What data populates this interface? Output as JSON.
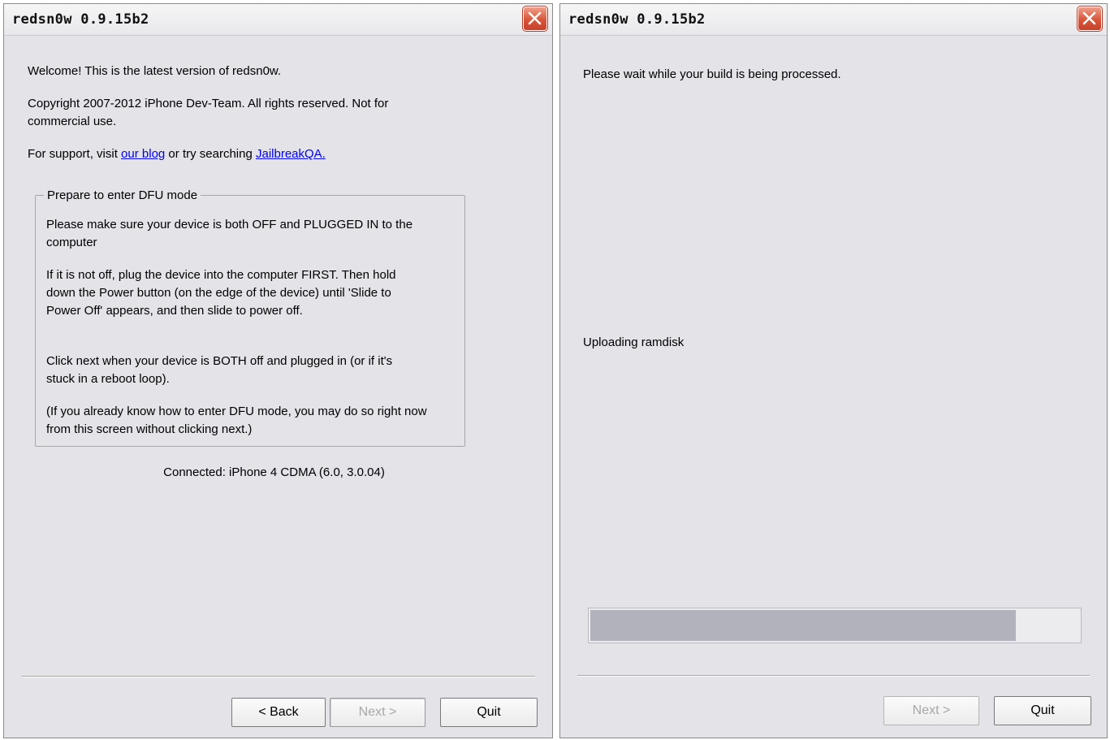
{
  "left_window": {
    "title": "redsn0w 0.9.15b2",
    "welcome": "Welcome!  This is the latest version of redsn0w.",
    "copyright": "Copyright 2007-2012 iPhone Dev-Team. All rights reserved. Not for commercial use.",
    "support_prefix": "For support, visit ",
    "support_link1": "our blog",
    "support_middle": " or try searching ",
    "support_link2": "JailbreakQA.",
    "dfu_group": {
      "legend": "Prepare to enter DFU mode",
      "para1": "Please make sure your device is both OFF and PLUGGED IN to the computer",
      "para2": "If it is not off, plug the device into the computer FIRST. Then hold down the Power button (on the edge of the device) until 'Slide to Power Off' appears, and then slide to power off.",
      "para3": "Click next when your device is BOTH off and plugged in (or if it's stuck in a reboot loop).",
      "para4": "(If you already know how to enter DFU mode, you may do so right now from this screen without clicking next.)"
    },
    "connected": "Connected: iPhone 4 CDMA (6.0, 3.0.04)",
    "buttons": {
      "back": "< Back",
      "next": "Next >",
      "quit": "Quit"
    }
  },
  "right_window": {
    "title": "redsn0w 0.9.15b2",
    "wait_message": "Please wait while your build is being processed.",
    "status": "Uploading ramdisk",
    "progress_fraction": 0.87,
    "buttons": {
      "next": "Next >",
      "quit": "Quit"
    }
  },
  "colors": {
    "window_bg": "#e3e3e8",
    "link": "#0000ee",
    "close_button": "#d9553a",
    "progress_fill": "#b1b2bc"
  },
  "icons": {
    "close": "close-x-icon"
  }
}
